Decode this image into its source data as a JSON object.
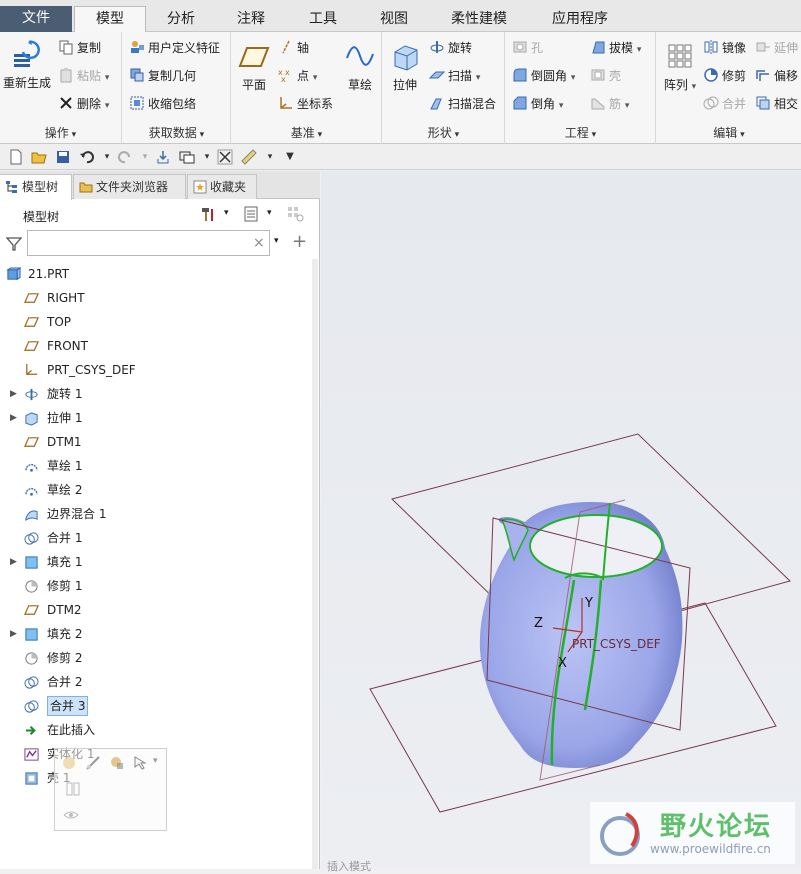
{
  "menu": {
    "tabs": [
      {
        "label": "文件"
      },
      {
        "label": "模型"
      },
      {
        "label": "分析"
      },
      {
        "label": "注释"
      },
      {
        "label": "工具"
      },
      {
        "label": "视图"
      },
      {
        "label": "柔性建模"
      },
      {
        "label": "应用程序"
      }
    ],
    "active": "模型"
  },
  "ribbon": {
    "operations": {
      "label": "操作",
      "regenerate": "重新生成",
      "copy": "复制",
      "paste": "粘贴",
      "delete": "删除"
    },
    "get_data": {
      "label": "获取数据",
      "udf": "用户定义特征",
      "copy_geom": "复制几何",
      "shrinkwrap": "收缩包络"
    },
    "datum": {
      "label": "基准",
      "plane": "平面",
      "axis": "轴",
      "point": "点",
      "csys": "坐标系",
      "sketch": "草绘"
    },
    "shapes": {
      "label": "形状",
      "extrude": "拉伸",
      "revolve": "旋转",
      "sweep": "扫描",
      "swept_blend": "扫描混合"
    },
    "engineering": {
      "label": "工程",
      "hole": "孔",
      "draft": "拔模",
      "round": "倒圆角",
      "shell": "壳",
      "chamfer": "倒角",
      "rib": "筋"
    },
    "editing": {
      "label": "编辑",
      "pattern": "阵列",
      "mirror": "镜像",
      "extend": "延伸",
      "trim": "修剪",
      "offset": "偏移",
      "merge": "合并",
      "intersect": "相交"
    }
  },
  "panel": {
    "tabs": [
      {
        "label": "模型树"
      },
      {
        "label": "文件夹浏览器"
      },
      {
        "label": "收藏夹"
      }
    ],
    "title": "模型树",
    "search_value": "",
    "search_clear": "×",
    "tree": [
      {
        "label": "21.PRT",
        "icon": "part-icon",
        "expandable": false
      },
      {
        "label": "RIGHT",
        "icon": "datum-plane-icon",
        "expandable": false
      },
      {
        "label": "TOP",
        "icon": "datum-plane-icon",
        "expandable": false
      },
      {
        "label": "FRONT",
        "icon": "datum-plane-icon",
        "expandable": false
      },
      {
        "label": "PRT_CSYS_DEF",
        "icon": "csys-icon",
        "expandable": false
      },
      {
        "label": "旋转 1",
        "icon": "revolve-icon",
        "expandable": true
      },
      {
        "label": "拉伸 1",
        "icon": "extrude-icon",
        "expandable": true
      },
      {
        "label": "DTM1",
        "icon": "datum-plane-icon",
        "expandable": false
      },
      {
        "label": "草绘 1",
        "icon": "sketch-icon",
        "expandable": false
      },
      {
        "label": "草绘 2",
        "icon": "sketch-icon",
        "expandable": false
      },
      {
        "label": "边界混合 1",
        "icon": "boundary-blend-icon",
        "expandable": false
      },
      {
        "label": "合并 1",
        "icon": "merge-icon",
        "expandable": false
      },
      {
        "label": "填充 1",
        "icon": "fill-icon",
        "expandable": true
      },
      {
        "label": "修剪 1",
        "icon": "trim-icon",
        "expandable": false
      },
      {
        "label": "DTM2",
        "icon": "datum-plane-icon",
        "expandable": false
      },
      {
        "label": "填充 2",
        "icon": "fill-icon",
        "expandable": true
      },
      {
        "label": "修剪 2",
        "icon": "trim-icon",
        "expandable": false
      },
      {
        "label": "合并 2",
        "icon": "merge-icon",
        "expandable": false
      },
      {
        "label": "合并 3",
        "icon": "merge-icon",
        "expandable": false,
        "selected": true
      },
      {
        "label": "在此插入",
        "icon": "insert-here-arrow-icon",
        "expandable": false
      },
      {
        "label": "实体化 1",
        "icon": "solidify-icon",
        "expandable": false
      },
      {
        "label": "壳 1",
        "icon": "shell-icon",
        "expandable": false
      }
    ]
  },
  "viewport": {
    "labels": {
      "z": "Z",
      "y": "Y",
      "x": "X",
      "csys": "PRT_CSYS_DEF"
    },
    "model_color": "#9aa6e8",
    "edge_color": "#22b02a",
    "datum_color": "#7a3a4a",
    "status": "插入模式"
  },
  "watermark": {
    "title": "野火论坛",
    "url": "www.proewildfire.cn"
  }
}
